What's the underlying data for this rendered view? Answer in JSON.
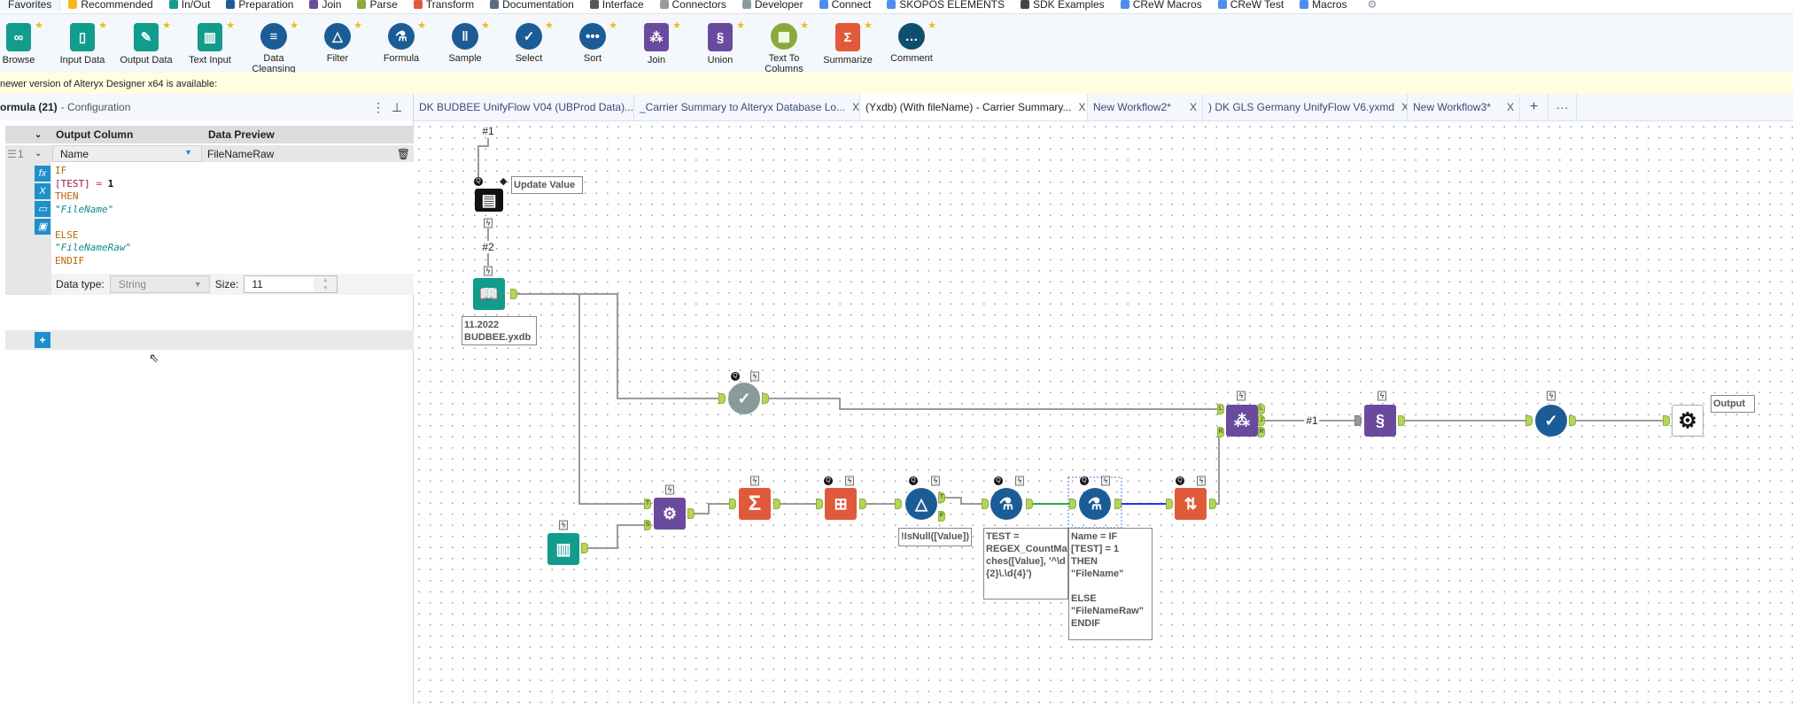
{
  "categories": [
    {
      "label": "Favorites",
      "color": ""
    },
    {
      "label": "Recommended",
      "color": "#f3b81f"
    },
    {
      "label": "In/Out",
      "color": "#119c8c"
    },
    {
      "label": "Preparation",
      "color": "#1b5c96"
    },
    {
      "label": "Join",
      "color": "#6a4a9e"
    },
    {
      "label": "Parse",
      "color": "#8aaa3c"
    },
    {
      "label": "Transform",
      "color": "#e05a3a"
    },
    {
      "label": "Documentation",
      "color": "#5b6b82"
    },
    {
      "label": "Interface",
      "color": "#555"
    },
    {
      "label": "Connectors",
      "color": "#9a9a9a"
    },
    {
      "label": "Developer",
      "color": "#8a9a9a"
    },
    {
      "label": "Connect",
      "color": "#4d8df0"
    },
    {
      "label": "SKOPOS ELEMENTS",
      "color": "#4d8df0"
    },
    {
      "label": "SDK Examples",
      "color": "#444"
    },
    {
      "label": "CReW Macros",
      "color": "#4d8df0"
    },
    {
      "label": "CReW Test",
      "color": "#4d8df0"
    },
    {
      "label": "Macros",
      "color": "#4d8df0"
    }
  ],
  "palette": [
    {
      "label": "Browse",
      "icon": "binoculars-icon",
      "color": "#119c8c"
    },
    {
      "label": "Input Data",
      "icon": "book-icon",
      "color": "#119c8c"
    },
    {
      "label": "Output Data",
      "icon": "notepad-icon",
      "color": "#119c8c"
    },
    {
      "label": "Text Input",
      "icon": "book-table-icon",
      "color": "#119c8c"
    },
    {
      "label": "Data Cleansing",
      "icon": "broom-icon",
      "color": "#1b5c96"
    },
    {
      "label": "Filter",
      "icon": "filter-icon",
      "color": "#1b5c96"
    },
    {
      "label": "Formula",
      "icon": "flask-icon",
      "color": "#1b5c96"
    },
    {
      "label": "Sample",
      "icon": "tubes-icon",
      "color": "#1b5c96"
    },
    {
      "label": "Select",
      "icon": "check-icon",
      "color": "#1b5c96"
    },
    {
      "label": "Sort",
      "icon": "sort-icon",
      "color": "#1b5c96"
    },
    {
      "label": "Join",
      "icon": "join-icon",
      "color": "#6a4a9e"
    },
    {
      "label": "Union",
      "icon": "dna-icon",
      "color": "#6a4a9e"
    },
    {
      "label": "Text To Columns",
      "icon": "columns-icon",
      "color": "#8aaa3c"
    },
    {
      "label": "Summarize",
      "icon": "sigma-icon",
      "color": "#e05a3a"
    },
    {
      "label": "Comment",
      "icon": "speech-bubble-icon",
      "color": "#0f4f6e"
    }
  ],
  "notice": "newer version of Alteryx Designer x64 is available:",
  "config": {
    "title": "ormula (21)",
    "subtitle": "- Configuration",
    "col_output": "Output Column",
    "col_preview": "Data Preview",
    "row_num": "1",
    "output_column": "Name",
    "preview": "FileNameRaw",
    "expr": {
      "l1": "IF",
      "l2a": "[TEST]",
      "l2b": "=",
      "l2c": "1",
      "l3": "THEN",
      "l4": "\"FileName\"",
      "l6": "ELSE",
      "l7": "\"FileNameRaw\"",
      "l8": "ENDIF"
    },
    "datatype_label": "Data type:",
    "datatype": "String",
    "size_label": "Size:",
    "size": "11"
  },
  "tabs": [
    {
      "label": "DK BUDBEE UnifyFlow V04 (UBProd Data)...",
      "active": false
    },
    {
      "label": "_Carrier Summary to Alteryx Database Lo...",
      "active": false
    },
    {
      "label": "(Yxdb) (With fileName) - Carrier Summary...",
      "active": true
    },
    {
      "label": "New Workflow2*",
      "active": false
    },
    {
      "label": ") DK GLS Germany UnifyFlow V6.yxmd",
      "active": false
    },
    {
      "label": "New Workflow3*",
      "active": false
    }
  ],
  "tab_close": "X",
  "tab_add": "+",
  "tab_more": "···",
  "canvas": {
    "wire1": "#1",
    "wire2": "#2",
    "wire3": "#1",
    "update_value": "Update Value",
    "input_label": "11.2022\nBUDBEE.yxdb",
    "filter_label": "!IsNull([Value])",
    "formula1_label": "TEST =\nREGEX_CountMat\nches([Value], '^\\d\n{2}\\.\\d{4}')",
    "formula2_label": "Name = IF\n[TEST] = 1\nTHEN\n\"FileName\"\n\nELSE\n\"FileNameRaw\"\nENDIF",
    "output_label": "Output"
  }
}
